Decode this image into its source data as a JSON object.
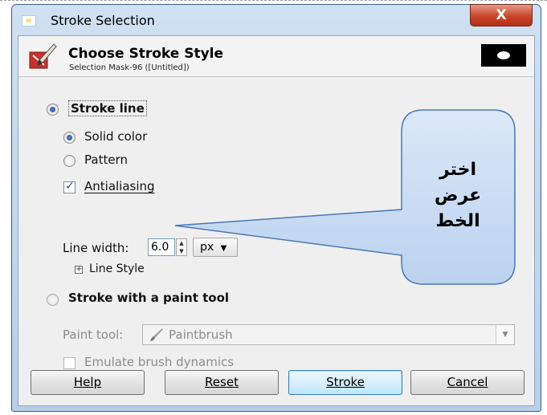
{
  "window": {
    "title": "Stroke Selection",
    "close_label": "X"
  },
  "header": {
    "title": "Choose Stroke Style",
    "subtitle": "Selection Mask-96 ([Untitled])"
  },
  "stroke_line": {
    "label": "Stroke line",
    "selected": true,
    "solid_color_label": "Solid color",
    "pattern_label": "Pattern",
    "fill_selected": "Solid color",
    "antialiasing_label": "Antialiasing",
    "antialiasing_checked": true,
    "line_width_label": "Line width:",
    "line_width_value": "6.0",
    "unit_value": "px",
    "line_style_label": "Line Style"
  },
  "paint_tool_section": {
    "label": "Stroke with a paint tool",
    "paint_tool_label": "Paint tool:",
    "paint_tool_value": "Paintbrush",
    "emulate_label": "Emulate brush dynamics",
    "emulate_checked": false
  },
  "buttons": {
    "help": "Help",
    "reset": "Reset",
    "stroke": "Stroke",
    "cancel": "Cancel"
  },
  "annotation": {
    "line1": "اختر",
    "line2": "عرض",
    "line3": "الخط"
  },
  "colors": {
    "callout_fill": "#cfe0f5",
    "callout_border": "#4a78b5",
    "accent": "#1f4f95"
  }
}
